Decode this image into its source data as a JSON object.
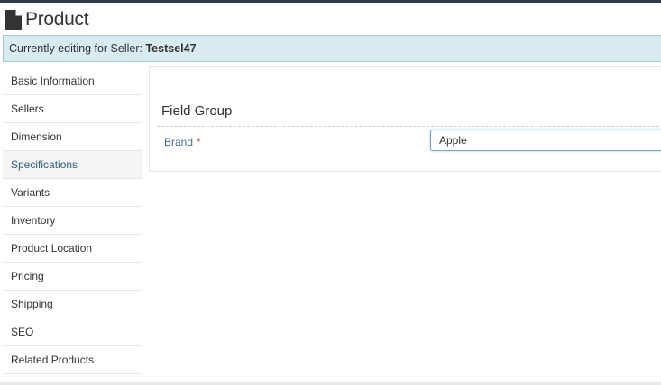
{
  "header": {
    "title": "Product",
    "icon": "file-icon"
  },
  "seller_bar": {
    "prefix": "Currently editing for Seller:",
    "seller_name": "Testsel47"
  },
  "sidebar": {
    "items": [
      {
        "label": "Basic Information"
      },
      {
        "label": "Sellers"
      },
      {
        "label": "Dimension"
      },
      {
        "label": "Specifications"
      },
      {
        "label": "Variants"
      },
      {
        "label": "Inventory"
      },
      {
        "label": "Product Location"
      },
      {
        "label": "Pricing"
      },
      {
        "label": "Shipping"
      },
      {
        "label": "SEO"
      },
      {
        "label": "Related Products"
      }
    ],
    "active_index": 3
  },
  "main": {
    "field_group_title": "Field Group",
    "fields": [
      {
        "label": "Brand",
        "required_mark": "*",
        "value": "Apple"
      }
    ]
  },
  "colors": {
    "accent_bar": "#d8ebf1",
    "label_blue": "#3f6f8f",
    "required_red": "#d9534f"
  }
}
